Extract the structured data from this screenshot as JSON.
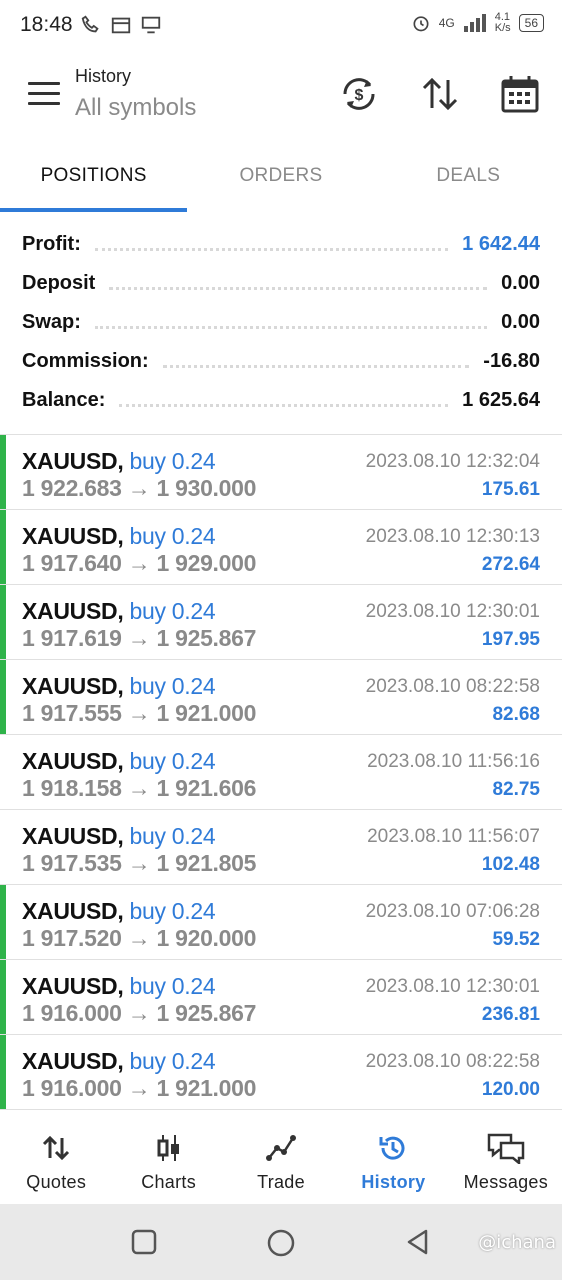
{
  "status_bar": {
    "time": "18:48",
    "net_speed": "4.1\nK/s",
    "net_type": "4G",
    "battery": "56"
  },
  "app_bar": {
    "title": "History",
    "subtitle": "All symbols"
  },
  "tabs": [
    {
      "label": "POSITIONS",
      "active": true
    },
    {
      "label": "ORDERS",
      "active": false
    },
    {
      "label": "DEALS",
      "active": false
    }
  ],
  "summary": [
    {
      "label": "Profit:",
      "value": "1 642.44",
      "highlight": true
    },
    {
      "label": "Deposit",
      "value": "0.00",
      "highlight": false
    },
    {
      "label": "Swap:",
      "value": "0.00",
      "highlight": false
    },
    {
      "label": "Commission:",
      "value": "-16.80",
      "highlight": false
    },
    {
      "label": "Balance:",
      "value": "1 625.64",
      "highlight": false
    }
  ],
  "deals": [
    {
      "symbol": "XAUUSD,",
      "type": "buy 0.24",
      "prices": "1 922.683 → 1 930.000",
      "datetime": "2023.08.10 12:32:04",
      "profit": "175.61",
      "marker": true
    },
    {
      "symbol": "XAUUSD,",
      "type": "buy 0.24",
      "prices": "1 917.640 → 1 929.000",
      "datetime": "2023.08.10 12:30:13",
      "profit": "272.64",
      "marker": true
    },
    {
      "symbol": "XAUUSD,",
      "type": "buy 0.24",
      "prices": "1 917.619 → 1 925.867",
      "datetime": "2023.08.10 12:30:01",
      "profit": "197.95",
      "marker": true
    },
    {
      "symbol": "XAUUSD,",
      "type": "buy 0.24",
      "prices": "1 917.555 → 1 921.000",
      "datetime": "2023.08.10 08:22:58",
      "profit": "82.68",
      "marker": true
    },
    {
      "symbol": "XAUUSD,",
      "type": "buy 0.24",
      "prices": "1 918.158 → 1 921.606",
      "datetime": "2023.08.10 11:56:16",
      "profit": "82.75",
      "marker": false
    },
    {
      "symbol": "XAUUSD,",
      "type": "buy 0.24",
      "prices": "1 917.535 → 1 921.805",
      "datetime": "2023.08.10 11:56:07",
      "profit": "102.48",
      "marker": false
    },
    {
      "symbol": "XAUUSD,",
      "type": "buy 0.24",
      "prices": "1 917.520 → 1 920.000",
      "datetime": "2023.08.10 07:06:28",
      "profit": "59.52",
      "marker": true
    },
    {
      "symbol": "XAUUSD,",
      "type": "buy 0.24",
      "prices": "1 916.000 → 1 925.867",
      "datetime": "2023.08.10 12:30:01",
      "profit": "236.81",
      "marker": true
    },
    {
      "symbol": "XAUUSD,",
      "type": "buy 0.24",
      "prices": "1 916.000 → 1 921.000",
      "datetime": "2023.08.10 08:22:58",
      "profit": "120.00",
      "marker": true
    }
  ],
  "bottom_nav": [
    {
      "label": "Quotes",
      "icon": "quotes-icon",
      "active": false
    },
    {
      "label": "Charts",
      "icon": "charts-icon",
      "active": false
    },
    {
      "label": "Trade",
      "icon": "trade-icon",
      "active": false
    },
    {
      "label": "History",
      "icon": "history-icon",
      "active": true
    },
    {
      "label": "Messages",
      "icon": "messages-icon",
      "active": false
    }
  ],
  "watermark": "@ichana",
  "colors": {
    "accent": "#2f7bd8",
    "marker": "#2fb34a",
    "muted": "#8a8a8a"
  }
}
